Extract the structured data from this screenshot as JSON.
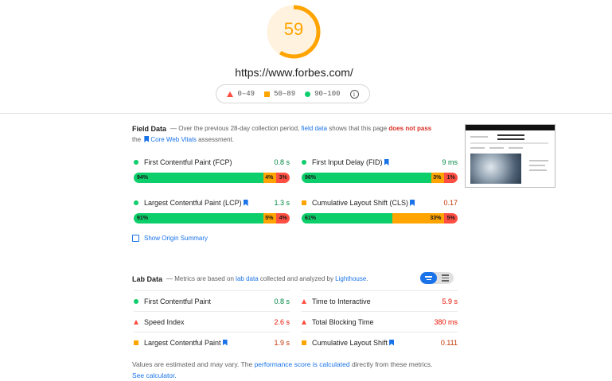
{
  "score": {
    "value": "59",
    "fraction": 0.59,
    "color": "#ffa400"
  },
  "url": "https://www.forbes.com/",
  "legend": {
    "poor": "0–49",
    "average": "50–89",
    "good": "90–100"
  },
  "field": {
    "title": "Field Data",
    "desc_a": "— Over the previous 28-day collection period,",
    "link_field_data": "field data",
    "desc_b": "shows that this page",
    "fail_text": "does not pass",
    "desc_c": "the",
    "link_cwv": "Core Web Vitals",
    "desc_d": "assessment.",
    "metrics": [
      {
        "name": "First Contentful Paint (FCP)",
        "value": "0.8 s",
        "status": "good",
        "good": "94%",
        "avg": "4%",
        "poor": "3%",
        "good_pct": 0.94,
        "avg_pct": 0.04,
        "poor_pct": 0.03
      },
      {
        "name": "First Input Delay (FID)",
        "value": "9 ms",
        "status": "good",
        "good": "96%",
        "avg": "3%",
        "poor": "1%",
        "good_pct": 0.96,
        "avg_pct": 0.03,
        "poor_pct": 0.01
      },
      {
        "name": "Largest Contentful Paint (LCP)",
        "value": "1.3 s",
        "status": "good",
        "good": "91%",
        "avg": "5%",
        "poor": "4%",
        "good_pct": 0.91,
        "avg_pct": 0.05,
        "poor_pct": 0.04
      },
      {
        "name": "Cumulative Layout Shift (CLS)",
        "value": "0.17",
        "status": "average",
        "good": "61%",
        "avg": "33%",
        "poor": "5%",
        "good_pct": 0.61,
        "avg_pct": 0.33,
        "poor_pct": 0.05
      }
    ],
    "show_origin": "Show Origin Summary"
  },
  "lab": {
    "title": "Lab Data",
    "desc_a": "— Metrics are based on",
    "link_lab_data": "lab data",
    "desc_b": "collected and analyzed by",
    "link_lighthouse": "Lighthouse",
    "desc_c": ".",
    "metrics": [
      {
        "name": "First Contentful Paint",
        "value": "0.8 s",
        "status": "good"
      },
      {
        "name": "Time to Interactive",
        "value": "5.9 s",
        "status": "poor"
      },
      {
        "name": "Speed Index",
        "value": "2.6 s",
        "status": "poor"
      },
      {
        "name": "Total Blocking Time",
        "value": "380 ms",
        "status": "poor"
      },
      {
        "name": "Largest Contentful Paint",
        "value": "1.9 s",
        "status": "average"
      },
      {
        "name": "Cumulative Layout Shift",
        "value": "0.111",
        "status": "average"
      }
    ]
  },
  "footer": {
    "text_a": "Values are estimated and may vary. The",
    "link_perf": "performance score is calculated",
    "text_b": "directly from these metrics.",
    "link_calc": "See calculator."
  }
}
